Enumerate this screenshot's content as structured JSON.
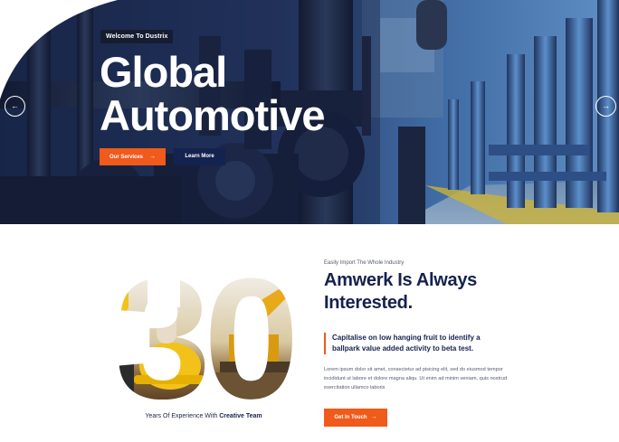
{
  "hero": {
    "badge": "Welcome To Dustrix",
    "title_line1": "Global",
    "title_line2": "Automotive",
    "buttons": {
      "services": "Our Services",
      "learn_more": "Learn More"
    },
    "arrow_icon": "→",
    "prev_icon": "←",
    "next_icon": "→"
  },
  "about": {
    "experience_number": "30",
    "experience_text": "Years Of Experience With",
    "experience_strong": "Creative Team",
    "eyebrow": "Easily Import The Whole Industry",
    "title": "Amwerk Is Always Interested.",
    "quote": "Capitalise on low hanging fruit to identify a ballpark value added activity to beta test.",
    "paragraph": "Lorem ipsum dolor sit amet, consectetur ad pisicing elit, sed do eiusmod tempor incididunt ut labore et dolore magna aliqu. Ut enim ad minim veniam, quis nostrud exercitation ullamco laboris",
    "cta": "Get In Touch",
    "cta_arrow": "→"
  },
  "colors": {
    "accent": "#f05a1a",
    "navy": "#14224f",
    "hero_tint": "#2c4d86"
  },
  "icons": {
    "prev": "arrow-left-icon",
    "next": "arrow-right-icon",
    "button_arrow": "arrow-right-icon"
  }
}
